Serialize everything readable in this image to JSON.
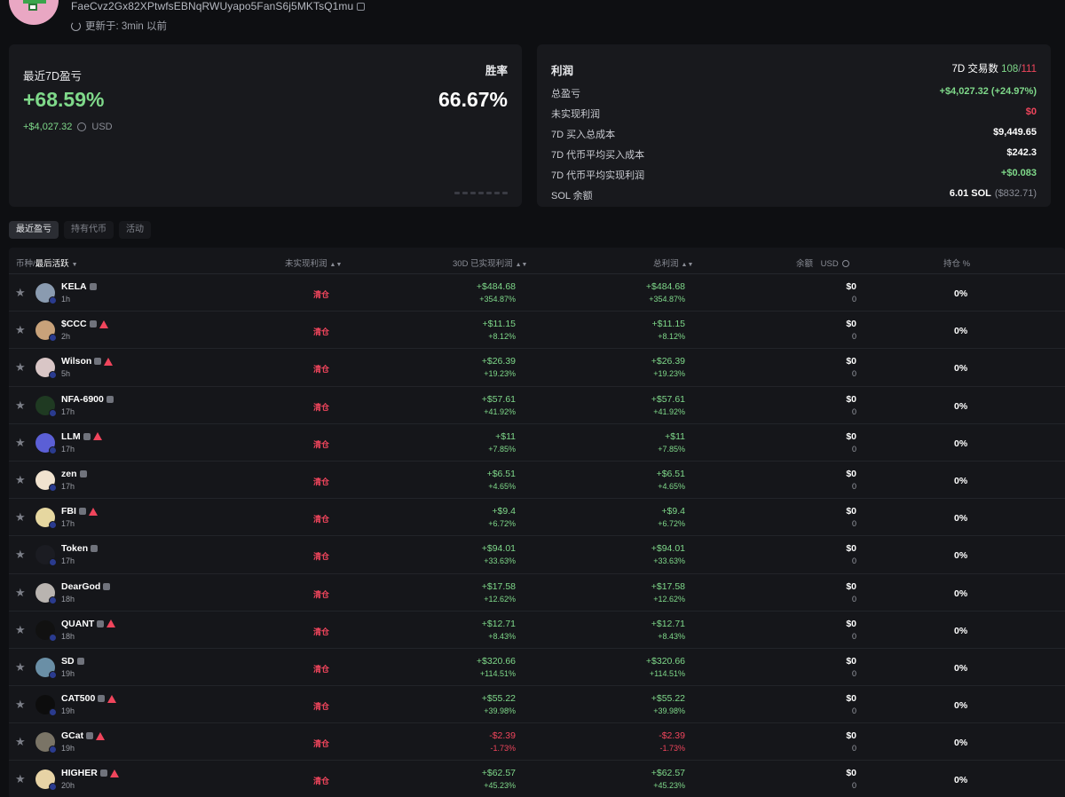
{
  "header": {
    "address": "FaeCvz2Gx82XPtwfsEBNqRWUyapo5FanS6j5MKTsQ1mu",
    "updated": "更新于: 3min 以前"
  },
  "pnl_card": {
    "title": "最近7D盈亏",
    "pct": "+68.59%",
    "usd": "+$4,027.32",
    "currency": "USD",
    "winrate_label": "胜率",
    "winrate": "66.67%"
  },
  "profit_card": {
    "title": "利润",
    "trades_label": "7D 交易数",
    "trades_win": "108",
    "trades_sep": "/",
    "trades_loss": "111",
    "rows": [
      {
        "label": "总盈亏",
        "value": "+$4,027.32 (+24.97%)",
        "tone": "green"
      },
      {
        "label": "未实现利润",
        "value": "$0",
        "tone": "red"
      },
      {
        "label": "7D 买入总成本",
        "value": "$9,449.65",
        "tone": "white"
      },
      {
        "label": "7D 代币平均买入成本",
        "value": "$242.3",
        "tone": "white"
      },
      {
        "label": "7D 代币平均实现利润",
        "value": "+$0.083",
        "tone": "green"
      },
      {
        "label": "SOL 余额",
        "value": "6.01 SOL",
        "value_extra": "($832.71)",
        "tone": "white"
      }
    ]
  },
  "tabs": [
    "最近盈亏",
    "持有代币",
    "活动"
  ],
  "table": {
    "headers": {
      "token": "币种/",
      "token_sort": "最后活跃",
      "unrealized": "未实现利润",
      "realized30": "30D 已实现利润",
      "total": "总利润",
      "balance": "余额",
      "balance_unit": "USD",
      "hold": "持仓 %"
    },
    "rows": [
      {
        "name": "KELA",
        "time": "1h",
        "warn": false,
        "unreal": "清仓",
        "r30": "+$484.68",
        "r30p": "+354.87%",
        "tot": "+$484.68",
        "totp": "+354.87%",
        "bal": "$0",
        "balsub": "0",
        "hold": "0%",
        "neg": false,
        "color": "#8a9bb0"
      },
      {
        "name": "$CCC",
        "time": "2h",
        "warn": true,
        "unreal": "清仓",
        "r30": "+$11.15",
        "r30p": "+8.12%",
        "tot": "+$11.15",
        "totp": "+8.12%",
        "bal": "$0",
        "balsub": "0",
        "hold": "0%",
        "neg": false,
        "color": "#c8a27a"
      },
      {
        "name": "Wilson",
        "time": "5h",
        "warn": true,
        "unreal": "清仓",
        "r30": "+$26.39",
        "r30p": "+19.23%",
        "tot": "+$26.39",
        "totp": "+19.23%",
        "bal": "$0",
        "balsub": "0",
        "hold": "0%",
        "neg": false,
        "color": "#d9c6c6"
      },
      {
        "name": "NFA-6900",
        "time": "17h",
        "warn": false,
        "unreal": "清仓",
        "r30": "+$57.61",
        "r30p": "+41.92%",
        "tot": "+$57.61",
        "totp": "+41.92%",
        "bal": "$0",
        "balsub": "0",
        "hold": "0%",
        "neg": false,
        "color": "#1f3a22"
      },
      {
        "name": "LLM",
        "time": "17h",
        "warn": true,
        "unreal": "清仓",
        "r30": "+$11",
        "r30p": "+7.85%",
        "tot": "+$11",
        "totp": "+7.85%",
        "bal": "$0",
        "balsub": "0",
        "hold": "0%",
        "neg": false,
        "color": "#5b5fd6"
      },
      {
        "name": "zen",
        "time": "17h",
        "warn": false,
        "unreal": "清仓",
        "r30": "+$6.51",
        "r30p": "+4.65%",
        "tot": "+$6.51",
        "totp": "+4.65%",
        "bal": "$0",
        "balsub": "0",
        "hold": "0%",
        "neg": false,
        "color": "#f1e3cf"
      },
      {
        "name": "FBI",
        "time": "17h",
        "warn": true,
        "unreal": "清仓",
        "r30": "+$9.4",
        "r30p": "+6.72%",
        "tot": "+$9.4",
        "totp": "+6.72%",
        "bal": "$0",
        "balsub": "0",
        "hold": "0%",
        "neg": false,
        "color": "#e6d7a0"
      },
      {
        "name": "Token",
        "time": "17h",
        "warn": false,
        "unreal": "清仓",
        "r30": "+$94.01",
        "r30p": "+33.63%",
        "tot": "+$94.01",
        "totp": "+33.63%",
        "bal": "$0",
        "balsub": "0",
        "hold": "0%",
        "neg": false,
        "color": "#1b1c22"
      },
      {
        "name": "DearGod",
        "time": "18h",
        "warn": false,
        "unreal": "清仓",
        "r30": "+$17.58",
        "r30p": "+12.62%",
        "tot": "+$17.58",
        "totp": "+12.62%",
        "bal": "$0",
        "balsub": "0",
        "hold": "0%",
        "neg": false,
        "color": "#b9b4b0"
      },
      {
        "name": "QUANT",
        "time": "18h",
        "warn": true,
        "unreal": "清仓",
        "r30": "+$12.71",
        "r30p": "+8.43%",
        "tot": "+$12.71",
        "totp": "+8.43%",
        "bal": "$0",
        "balsub": "0",
        "hold": "0%",
        "neg": false,
        "color": "#111111"
      },
      {
        "name": "SD",
        "time": "19h",
        "warn": false,
        "unreal": "清仓",
        "r30": "+$320.66",
        "r30p": "+114.51%",
        "tot": "+$320.66",
        "totp": "+114.51%",
        "bal": "$0",
        "balsub": "0",
        "hold": "0%",
        "neg": false,
        "color": "#6a8fa6"
      },
      {
        "name": "CAT500",
        "time": "19h",
        "warn": true,
        "unreal": "清仓",
        "r30": "+$55.22",
        "r30p": "+39.98%",
        "tot": "+$55.22",
        "totp": "+39.98%",
        "bal": "$0",
        "balsub": "0",
        "hold": "0%",
        "neg": false,
        "color": "#0d0d0d"
      },
      {
        "name": "GCat",
        "time": "19h",
        "warn": true,
        "unreal": "清仓",
        "r30": "-$2.39",
        "r30p": "-1.73%",
        "tot": "-$2.39",
        "totp": "-1.73%",
        "bal": "$0",
        "balsub": "0",
        "hold": "0%",
        "neg": true,
        "color": "#7a7466"
      },
      {
        "name": "HIGHER",
        "time": "20h",
        "warn": true,
        "unreal": "清仓",
        "r30": "+$62.57",
        "r30p": "+45.23%",
        "tot": "+$62.57",
        "totp": "+45.23%",
        "bal": "$0",
        "balsub": "0",
        "hold": "0%",
        "neg": false,
        "color": "#e7d3a5"
      }
    ]
  }
}
